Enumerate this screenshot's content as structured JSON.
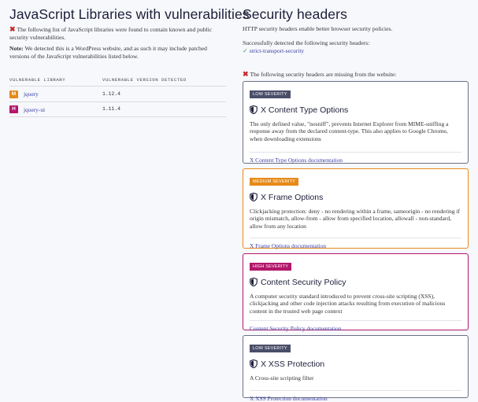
{
  "js": {
    "title": "JavaScript Libraries with vulnerabilities",
    "intro": "The following list of JavaScript libraries were found to contain known and public security vulnerabilities.",
    "note_label": "Note:",
    "note_text": " We detected this is a WordPress website, and as such it may include patched versions of the JavaScript vulnerabilities listed below.",
    "columns": [
      "VULNERABLE LIBRARY",
      "VULNERABLE VERSION DETECTED"
    ],
    "rows": [
      {
        "badge": "M",
        "name": "jquery",
        "version": "1.12.4"
      },
      {
        "badge": "H",
        "name": "jquery-ui",
        "version": "1.11.4"
      }
    ]
  },
  "security": {
    "title": "Security headers",
    "subtitle": "HTTP security headers enable better browser security policies.",
    "detected_text": "Successfully detected the following security headers:",
    "present": [
      "strict-transport-security"
    ],
    "missing_text": "The following security headers are missing from the website:",
    "headers": [
      {
        "severity": "LOW SEVERITY",
        "name": "X Content Type Options",
        "description": "The only defined value, \"nosniff\", prevents Internet Explorer from MIME-sniffing a response away from the declared content-type. This also applies to Google Chrome, when downloading extensions",
        "link": "X Content Type Options documentation"
      },
      {
        "severity": "MEDIUM SEVERITY",
        "name": "X Frame Options",
        "description": "Clickjacking protection: deny - no rendering within a frame, sameorigin - no rendering if origin mismatch, allow-from - allow from specified location, allowall - non-standard, allow from any location",
        "link": "X Frame Options documentation"
      },
      {
        "severity": "HIGH SEVERITY",
        "name": "Content Security Policy",
        "description": "A computer security standard introduced to prevent cross-site scripting (XSS), clickjacking and other code injection attacks resulting from execution of malicious content in the trusted web page context",
        "link": "Content Security Policy documentation"
      },
      {
        "severity": "LOW SEVERITY",
        "name": "X XSS Protection",
        "description": "A Cross-site scripting filter",
        "link": "X XSS Protection documentation"
      }
    ]
  },
  "colors": {
    "low": "#4a4e69",
    "medium": "#e68a19",
    "high": "#b3176b",
    "link": "#3b3fa3",
    "error": "#c62828",
    "ok": "#2e9e57"
  }
}
